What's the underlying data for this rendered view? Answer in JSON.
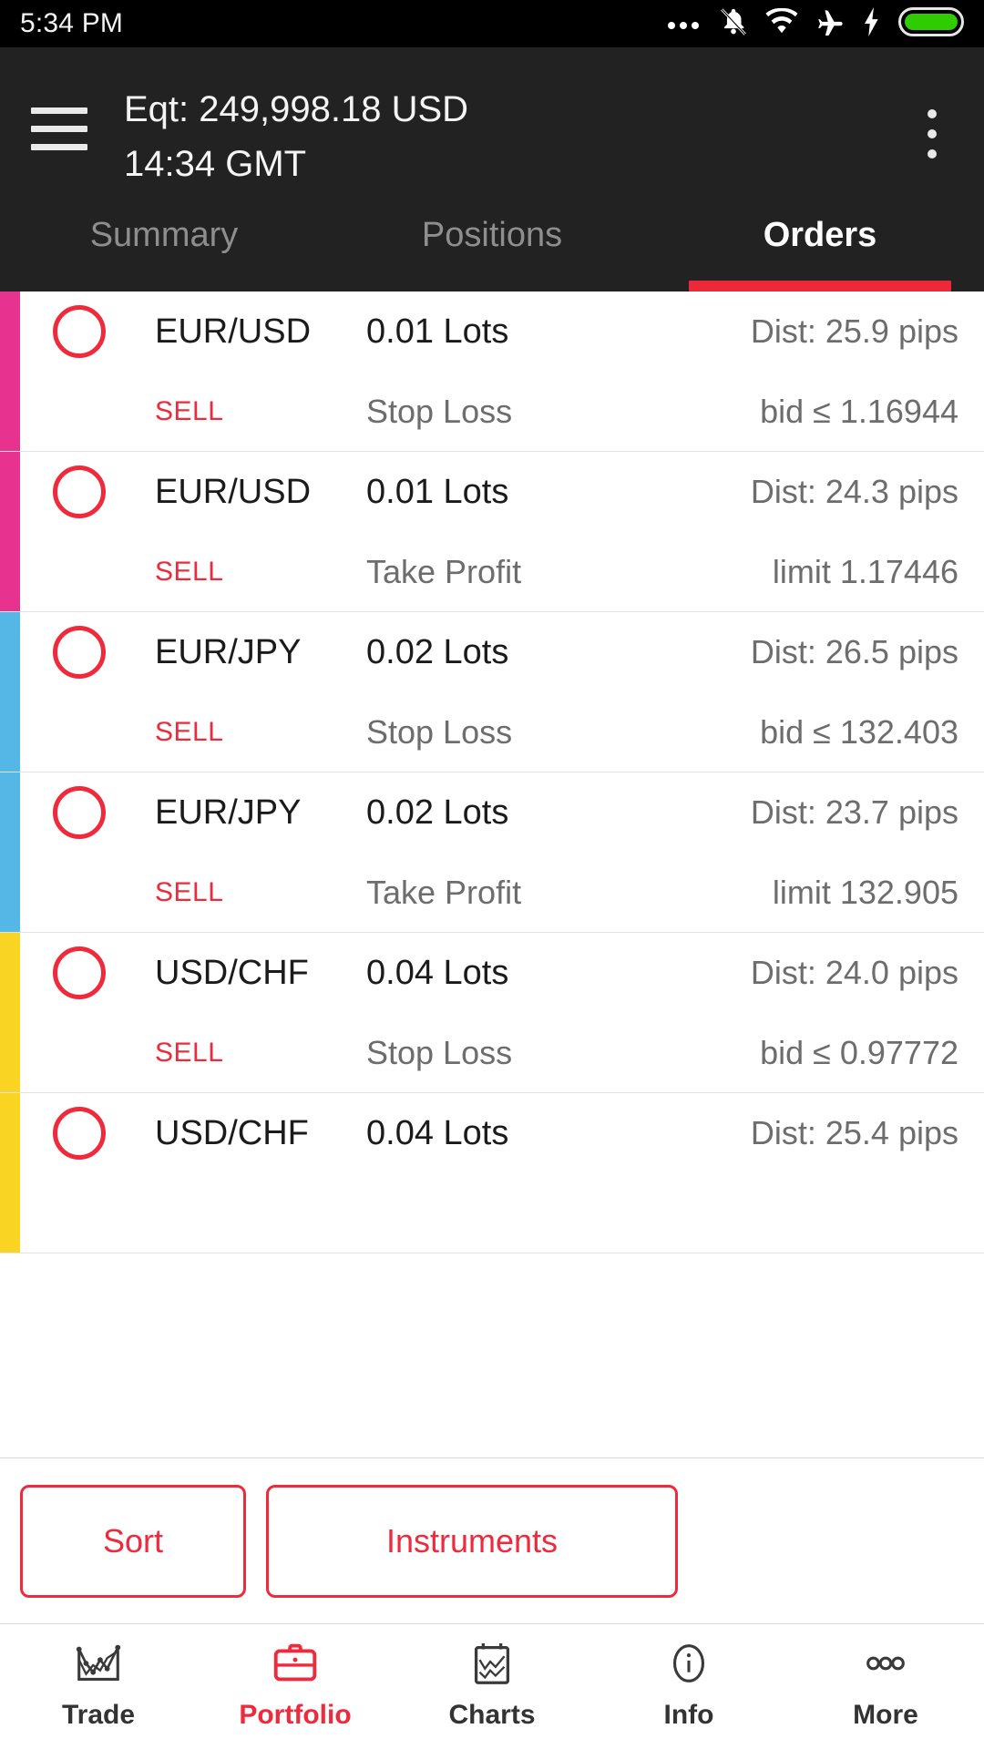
{
  "statusbar": {
    "time": "5:34 PM",
    "icons": [
      "more-dots-icon",
      "bell-muted-icon",
      "wifi-icon",
      "airplane-mode-icon",
      "charging-bolt-icon",
      "battery-icon"
    ]
  },
  "appbar": {
    "menu_icon": "hamburger-menu-icon",
    "overflow_icon": "overflow-menu-icon",
    "equity_line": "Eqt: 249,998.18 USD",
    "time_line": "14:34 GMT"
  },
  "tabs": [
    {
      "label": "Summary",
      "active": false
    },
    {
      "label": "Positions",
      "active": false
    },
    {
      "label": "Orders",
      "active": true
    }
  ],
  "orders": [
    {
      "symbol": "EUR/USD",
      "side": "SELL",
      "lots": "0.01 Lots",
      "kind": "Stop Loss",
      "dist": "Dist: 25.9 pips",
      "price": "bid ≤ 1.16944",
      "accent": "#E8328F"
    },
    {
      "symbol": "EUR/USD",
      "side": "SELL",
      "lots": "0.01 Lots",
      "kind": "Take Profit",
      "dist": "Dist: 24.3 pips",
      "price": "limit 1.17446",
      "accent": "#E8328F"
    },
    {
      "symbol": "EUR/JPY",
      "side": "SELL",
      "lots": "0.02 Lots",
      "kind": "Stop Loss",
      "dist": "Dist: 26.5 pips",
      "price": "bid ≤ 132.403",
      "accent": "#54B7E6"
    },
    {
      "symbol": "EUR/JPY",
      "side": "SELL",
      "lots": "0.02 Lots",
      "kind": "Take Profit",
      "dist": "Dist: 23.7 pips",
      "price": "limit 132.905",
      "accent": "#54B7E6"
    },
    {
      "symbol": "USD/CHF",
      "side": "SELL",
      "lots": "0.04 Lots",
      "kind": "Stop Loss",
      "dist": "Dist: 24.0 pips",
      "price": "bid ≤ 0.97772",
      "accent": "#F9D423"
    },
    {
      "symbol": "USD/CHF",
      "side": "SELL",
      "lots": "0.04 Lots",
      "kind": "",
      "dist": "Dist: 25.4 pips",
      "price": "",
      "accent": "#F9D423"
    }
  ],
  "actions": {
    "sort_label": "Sort",
    "instruments_label": "Instruments"
  },
  "bottomnav": [
    {
      "label": "Trade",
      "icon": "candlestick-chart-icon",
      "active": false
    },
    {
      "label": "Portfolio",
      "icon": "briefcase-icon",
      "active": true
    },
    {
      "label": "Charts",
      "icon": "clipboard-chart-icon",
      "active": false
    },
    {
      "label": "Info",
      "icon": "info-circle-icon",
      "active": false
    },
    {
      "label": "More",
      "icon": "more-dots-icon",
      "active": false
    }
  ],
  "colors": {
    "accent_red": "#ED2939",
    "appbar_bg": "#222222",
    "status_bg": "#000000",
    "battery_green": "#2ECC00"
  }
}
